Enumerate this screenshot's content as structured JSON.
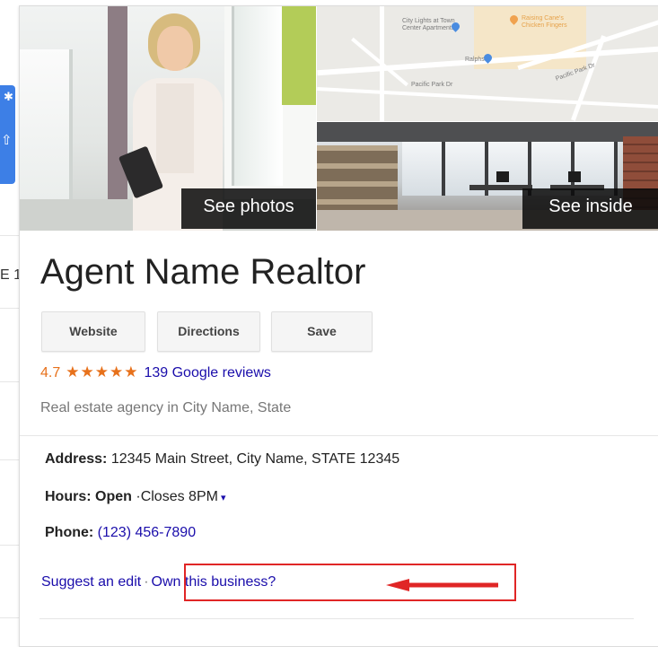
{
  "background": {
    "fragment_text": "E 1"
  },
  "card": {
    "photos": {
      "see_photos_label": "See photos",
      "see_inside_label": "See inside",
      "map_labels": {
        "poi_1": "City Lights at Town Center Apartments",
        "poi_2": "Raising Cane's Chicken Fingers",
        "poi_3": "Ralphs",
        "street_1": "Pacific Park Dr",
        "street_2": "Pacific Park Dr"
      }
    },
    "title": "Agent Name Realtor",
    "actions": {
      "website": "Website",
      "directions": "Directions",
      "save": "Save"
    },
    "rating": {
      "value": "4.7",
      "stars": "★★★★★",
      "stars_value": 4.7,
      "reviews_text": "139 Google reviews"
    },
    "category": "Real estate agency in City Name, State",
    "address": {
      "label": "Address:",
      "value": "12345 Main Street, City Name, STATE 12345"
    },
    "hours": {
      "label": "Hours:",
      "status": "Open",
      "closes": "·Closes 8PM",
      "toggle": "▾"
    },
    "phone": {
      "label": "Phone:",
      "value": "(123) 456-7890"
    },
    "footer": {
      "suggest_edit": "Suggest an edit",
      "separator": "·",
      "own_business": "Own this business?"
    }
  },
  "colors": {
    "link": "#1a0dab",
    "star": "#e7711b",
    "annotation": "#e02626",
    "side_tab": "#3d7fe6"
  }
}
